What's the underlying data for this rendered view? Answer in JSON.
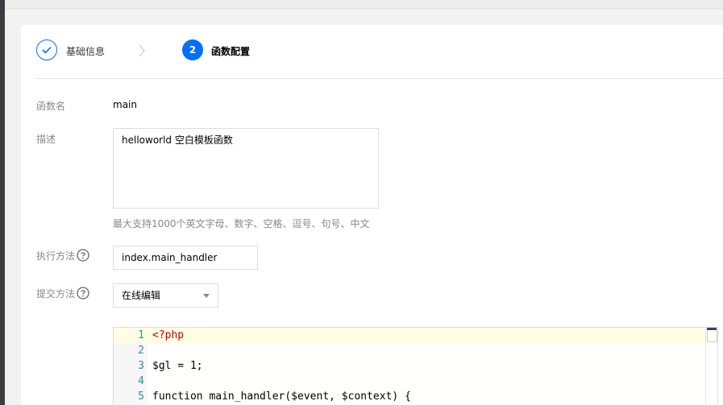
{
  "stepper": {
    "step1_label": "基础信息",
    "step2_number": "2",
    "step2_label": "函数配置"
  },
  "form": {
    "function_name_label": "函数名",
    "function_name_value": "main",
    "description_label": "描述",
    "description_value": "helloworld 空白模板函数",
    "description_hint": "最大支持1000个英文字母、数字、空格、逗号、句号、中文",
    "handler_label": "执行方法",
    "handler_value": "index.main_handler",
    "submit_method_label": "提交方法",
    "submit_method_value": "在线编辑"
  },
  "editor": {
    "lines": [
      {
        "n": "1",
        "text": "<?php"
      },
      {
        "n": "2",
        "text": ""
      },
      {
        "n": "3",
        "text": "$gl = 1;"
      },
      {
        "n": "4",
        "text": ""
      },
      {
        "n": "5",
        "text": "function main_handler($event, $context) {"
      }
    ]
  },
  "colors": {
    "accent": "#006eff"
  },
  "icons": {
    "step1": "check-icon",
    "separator": "chevron-right-icon",
    "help": "question-circle-icon",
    "dropdown": "caret-down-icon"
  }
}
